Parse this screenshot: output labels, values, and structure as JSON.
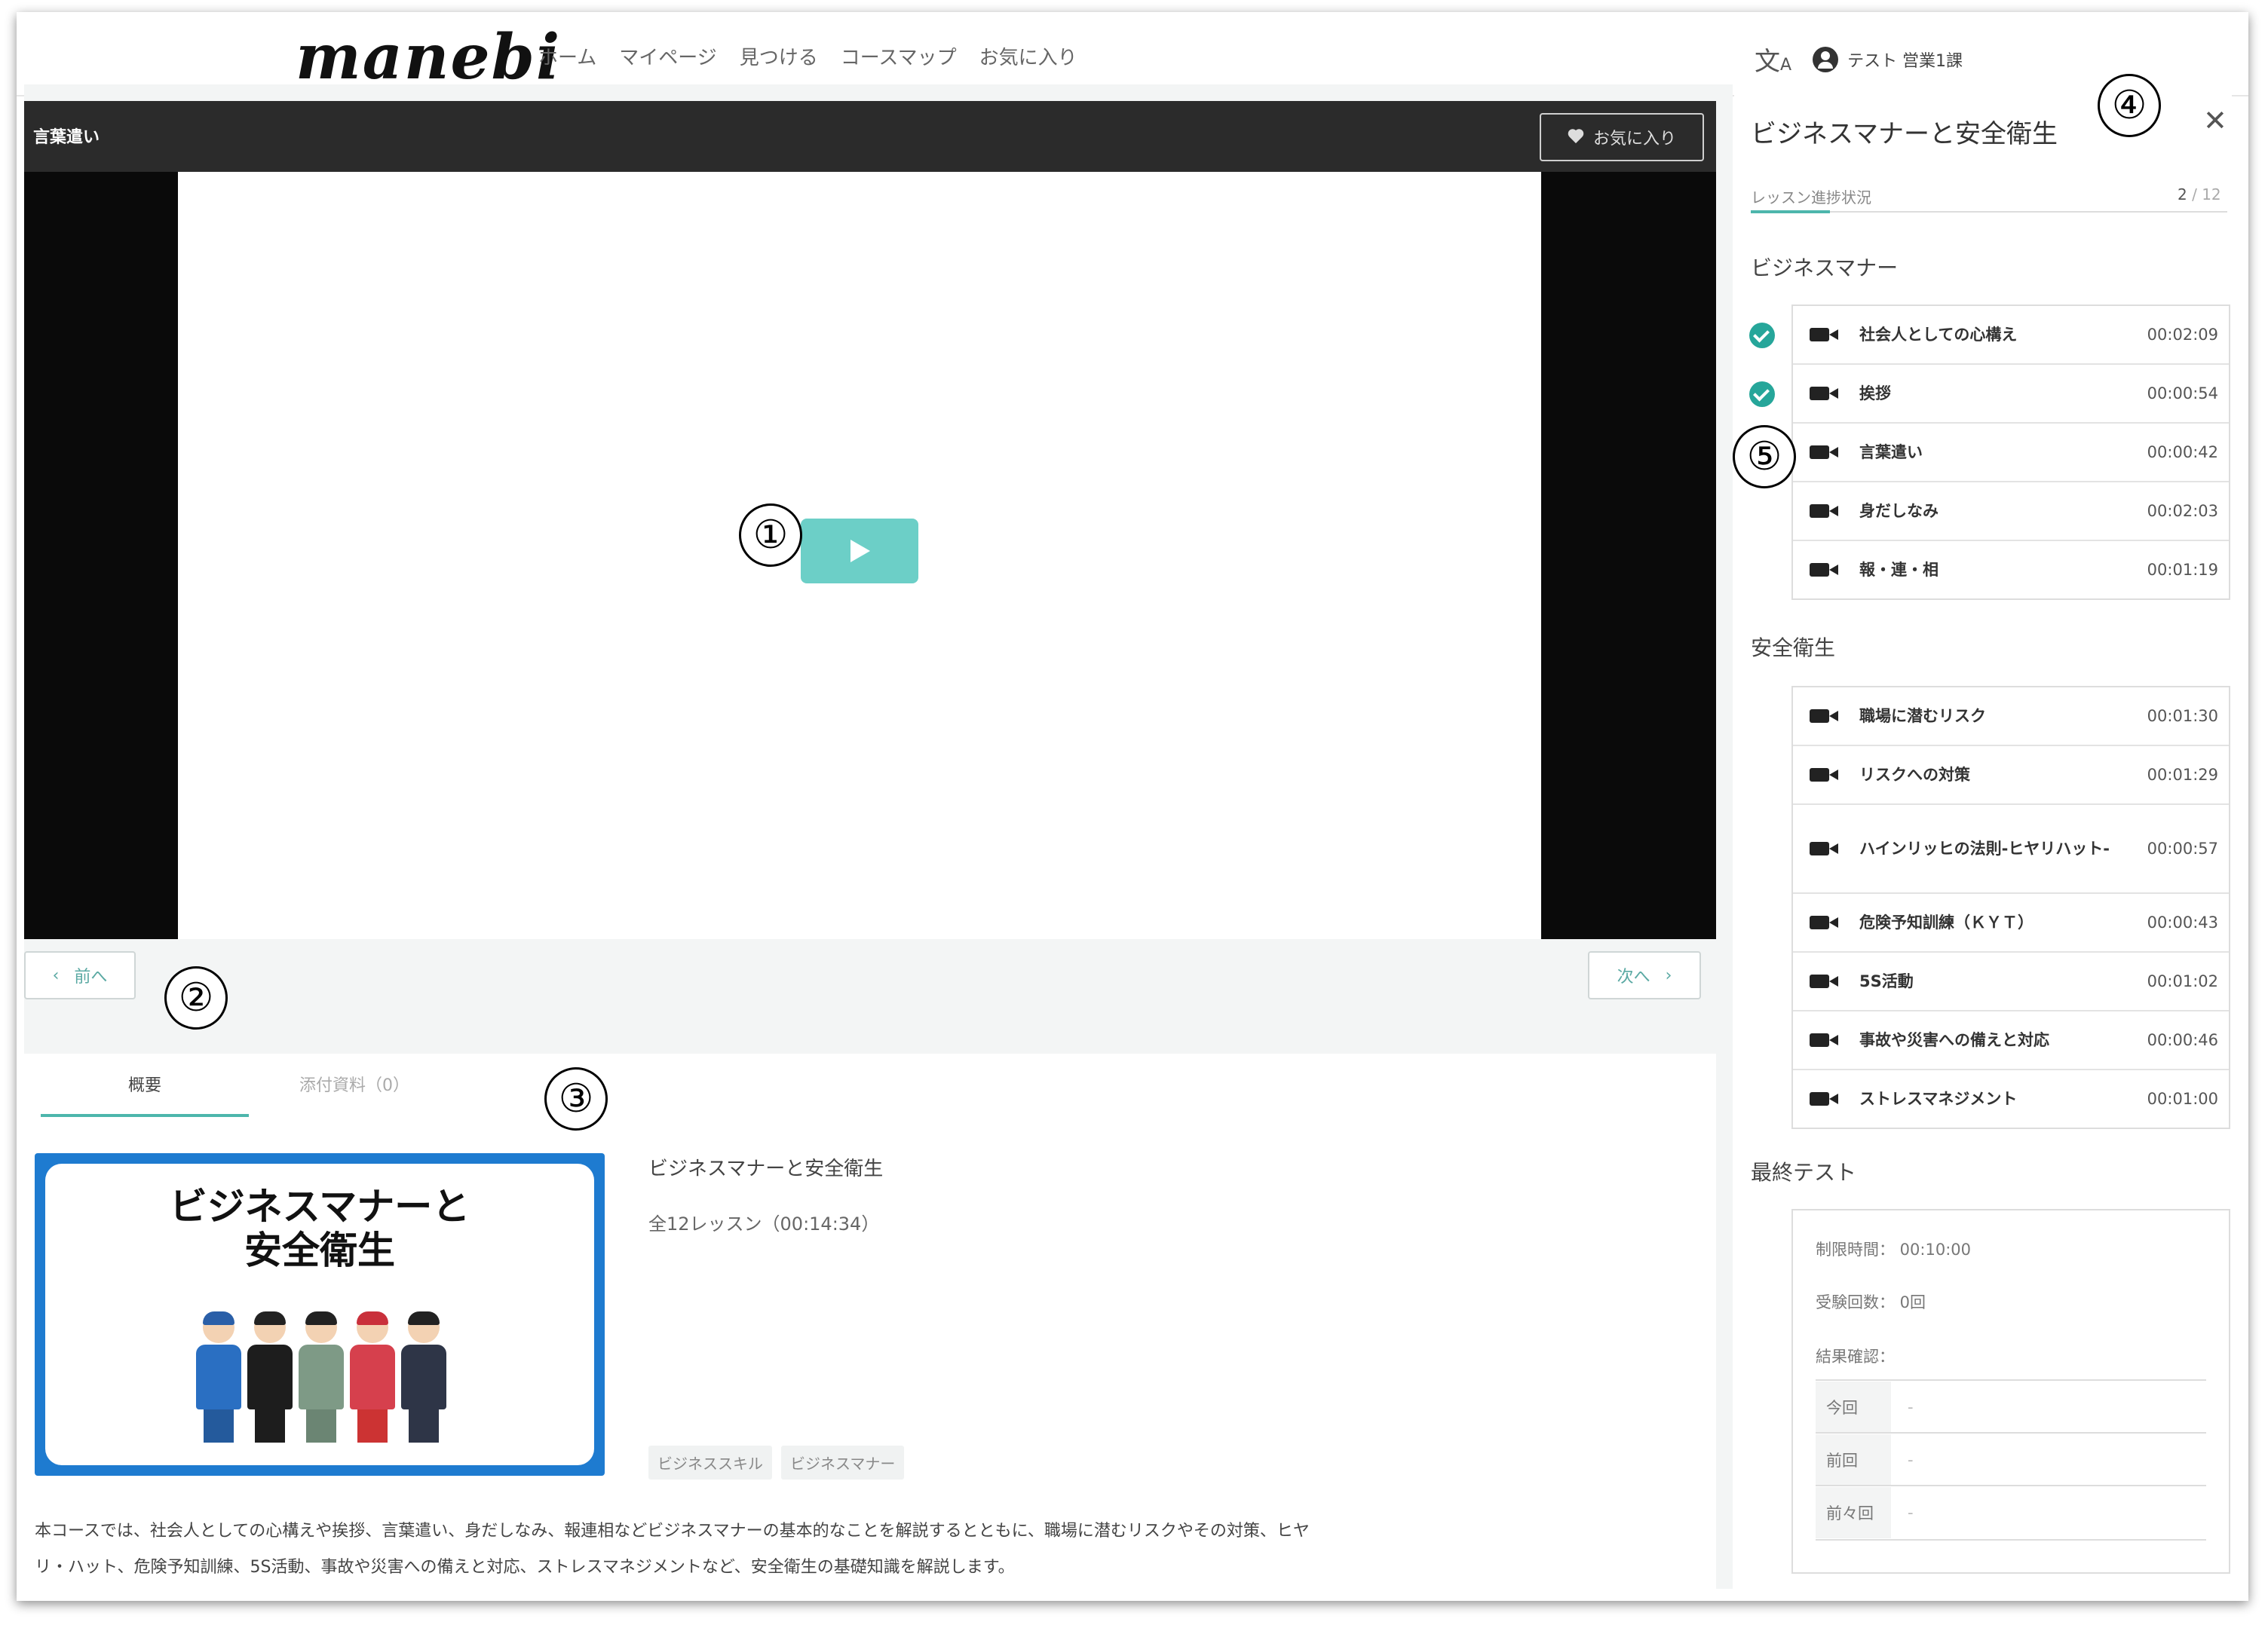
{
  "header": {
    "logo": "manebi",
    "nav": [
      "ホーム",
      "マイページ",
      "見つける",
      "コースマップ",
      "お気に入り"
    ],
    "translate_icon": "translate-icon",
    "user_name": "テスト 営業1課"
  },
  "video": {
    "lesson_title": "言葉遣い",
    "favorite_label": "お気に入り",
    "prev_label": "前へ",
    "next_label": "次へ"
  },
  "tabs": [
    "概要",
    "添付資料（0）"
  ],
  "course": {
    "thumbnail_title_line1": "ビジネスマナーと",
    "thumbnail_title_line2": "安全衛生",
    "title": "ビジネスマナーと安全衛生",
    "lessons_summary": "全12レッスン（00:14:34）",
    "tags": [
      "ビジネススキル",
      "ビジネスマナー"
    ],
    "description_line1": "本コースでは、社会人としての心構えや挨拶、言葉遣い、身だしなみ、報連相などビジネスマナーの基本的なことを解説するとともに、職場に潜むリスクやその対策、ヒヤ",
    "description_line2": "リ・ハット、危険予知訓練、5S活動、事故や災害への備えと対応、ストレスマネジメントなど、安全衛生の基礎知識を解説します。"
  },
  "sidebar": {
    "title": "ビジネスマナーと安全衛生",
    "progress_label": "レッスン進捗状況",
    "progress_done": "2",
    "progress_total": "/ 12",
    "progress_fraction": 0.1667,
    "sections": [
      {
        "title": "ビジネスマナー",
        "lessons": [
          {
            "name": "社会人としての心構え",
            "duration": "00:02:09",
            "done": true
          },
          {
            "name": "挨拶",
            "duration": "00:00:54",
            "done": true
          },
          {
            "name": "言葉遣い",
            "duration": "00:00:42",
            "done": false
          },
          {
            "name": "身だしなみ",
            "duration": "00:02:03",
            "done": false
          },
          {
            "name": "報・連・相",
            "duration": "00:01:19",
            "done": false
          }
        ]
      },
      {
        "title": "安全衛生",
        "lessons": [
          {
            "name": "職場に潜むリスク",
            "duration": "00:01:30",
            "done": false
          },
          {
            "name": "リスクへの対策",
            "duration": "00:01:29",
            "done": false
          },
          {
            "name": "ハインリッヒの法則-ヒヤリハット-",
            "duration": "00:00:57",
            "done": false
          },
          {
            "name": "危険予知訓練（ＫＹＴ）",
            "duration": "00:00:43",
            "done": false
          },
          {
            "name": "5S活動",
            "duration": "00:01:02",
            "done": false
          },
          {
            "name": "事故や災害への備えと対応",
            "duration": "00:00:46",
            "done": false
          },
          {
            "name": "ストレスマネジメント",
            "duration": "00:01:00",
            "done": false
          }
        ]
      }
    ],
    "final_test": {
      "title": "最終テスト",
      "time_limit": "制限時間： 00:10:00",
      "attempts": "受験回数： 0回",
      "results_label": "結果確認：",
      "results": [
        {
          "label": "今回",
          "value": "-"
        },
        {
          "label": "前回",
          "value": "-"
        },
        {
          "label": "前々回",
          "value": "-"
        }
      ]
    }
  },
  "markers": [
    "①",
    "②",
    "③",
    "④",
    "⑤"
  ],
  "colors": {
    "accent": "#4db6ac",
    "play": "#6ccfc7",
    "thumb_border": "#1e7bd0"
  }
}
